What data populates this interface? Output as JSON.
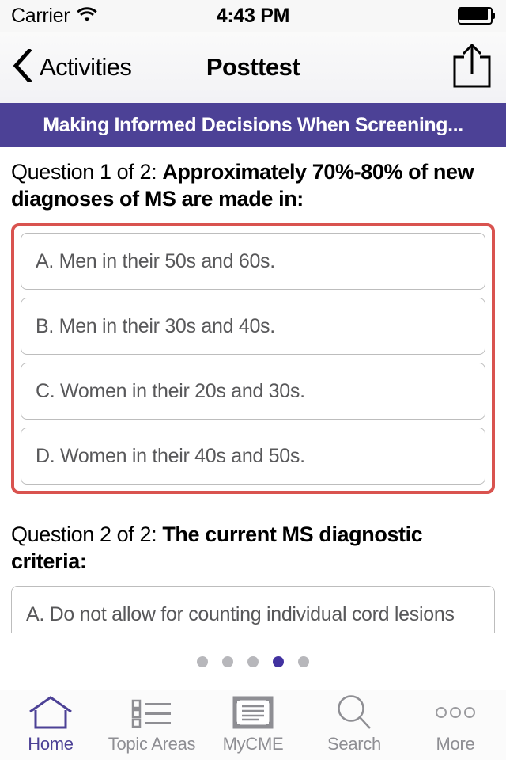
{
  "status_bar": {
    "carrier": "Carrier",
    "wifi_icon": "wifi-icon",
    "time": "4:43 PM",
    "battery_icon": "battery-full-icon"
  },
  "nav_bar": {
    "back_icon": "chevron-left-icon",
    "back_label": "Activities",
    "title": "Posttest",
    "share_icon": "share-icon"
  },
  "activity_banner": {
    "title": "Making Informed Decisions When Screening...",
    "background_color": "#4c4196"
  },
  "content": {
    "questions": [
      {
        "prefix": "Question 1 of 2: ",
        "body": "Approximately 70%-80% of new diagnoses of MS are made in:",
        "highlighted": true,
        "highlight_color": "#d9534f",
        "options": [
          "A. Men in their 50s and 60s.",
          "B. Men in their 30s and 40s.",
          "C. Women in their 20s and 30s.",
          "D. Women in their 40s and 50s."
        ]
      },
      {
        "prefix": "Question 2 of 2: ",
        "body": "The current MS diagnostic criteria:",
        "highlighted": false,
        "options": [
          "A. Do not allow for counting individual cord lesions"
        ]
      }
    ]
  },
  "page_dots": {
    "count": 5,
    "active_index": 3,
    "active_color": "#4232a0",
    "inactive_color": "#b7b7bb"
  },
  "tab_bar": {
    "active_index": 0,
    "active_color": "#4c4196",
    "inactive_color": "#8e8e93",
    "tabs": [
      {
        "label": "Home",
        "icon": "home-icon"
      },
      {
        "label": "Topic Areas",
        "icon": "list-icon"
      },
      {
        "label": "MyCME",
        "icon": "certificate-icon"
      },
      {
        "label": "Search",
        "icon": "search-icon"
      },
      {
        "label": "More",
        "icon": "ellipsis-icon"
      }
    ]
  }
}
